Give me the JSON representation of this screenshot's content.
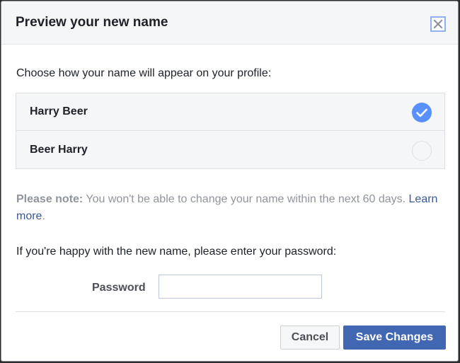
{
  "dialog": {
    "title": "Preview your new name",
    "close_icon": "close-icon",
    "prompt": "Choose how your name will appear on your profile:",
    "options": [
      {
        "label": "Harry Beer",
        "selected": true
      },
      {
        "label": "Beer Harry",
        "selected": false
      }
    ],
    "note": {
      "strong": "Please note:",
      "text": " You won't be able to change your name within the next 60 days.",
      "link": "Learn more",
      "link_suffix": "."
    },
    "password_prompt": "If you're happy with the new name, please enter your password:",
    "password_label": "Password",
    "password_value": "",
    "cancel_label": "Cancel",
    "save_label": "Save Changes"
  },
  "colors": {
    "accent": "#5890ff",
    "primary_button": "#4267b2",
    "link": "#365899"
  }
}
